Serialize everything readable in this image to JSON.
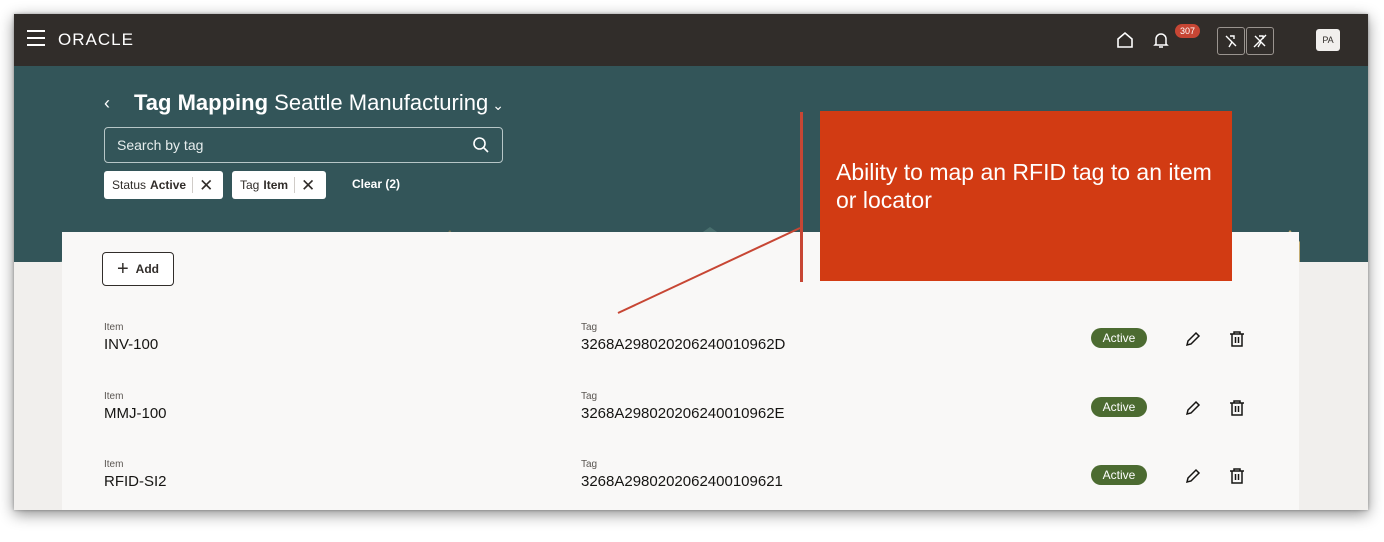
{
  "app": {
    "logo": "ORACLE",
    "notification_count": "307",
    "avatar_initials": "PA"
  },
  "page": {
    "title_bold": "Tag Mapping",
    "title_org": "Seattle Manufacturing",
    "search_placeholder": "Search by tag"
  },
  "filters": [
    {
      "key": "Status",
      "value": "Active"
    },
    {
      "key": "Tag",
      "value": "Item"
    }
  ],
  "clear_label": "Clear (2)",
  "add_label": "Add",
  "rows": [
    {
      "item_label": "Item",
      "item": "INV-100",
      "tag_label": "Tag",
      "tag": "3268A298020206240010962D",
      "status": "Active"
    },
    {
      "item_label": "Item",
      "item": "MMJ-100",
      "tag_label": "Tag",
      "tag": "3268A298020206240010962E",
      "status": "Active"
    },
    {
      "item_label": "Item",
      "item": "RFID-SI2",
      "tag_label": "Tag",
      "tag": "3268A2980202062400109621",
      "status": "Active"
    }
  ],
  "callout": {
    "text": "Ability to map an RFID tag to an item or locator"
  },
  "colors": {
    "topbar": "#312d2a",
    "header": "#335559",
    "status_active": "#4c6b31",
    "callout": "#d23b13"
  }
}
